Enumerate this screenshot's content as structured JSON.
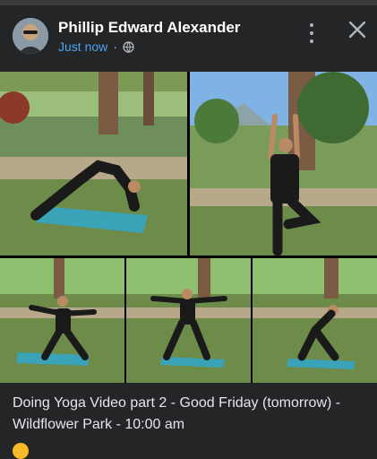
{
  "post": {
    "author": "Phillip Edward Alexander",
    "timestamp": "Just now",
    "separator": "·",
    "privacy_icon": "globe-icon",
    "caption": "Doing Yoga Video part 2 - Good Friday (tomorrow) - Wildflower Park - 10:00 am"
  },
  "header": {
    "more_icon": "more-vertical-icon",
    "close_icon": "close-icon"
  },
  "photos": [
    {
      "label": "photo-downward-dog"
    },
    {
      "label": "photo-tree-pose"
    },
    {
      "label": "photo-warrior-pose"
    },
    {
      "label": "photo-goddess-pose"
    },
    {
      "label": "photo-lunge-pose"
    }
  ],
  "colors": {
    "background": "#242526",
    "link_blue": "#4aa3f0",
    "text": "#e4e6eb"
  }
}
